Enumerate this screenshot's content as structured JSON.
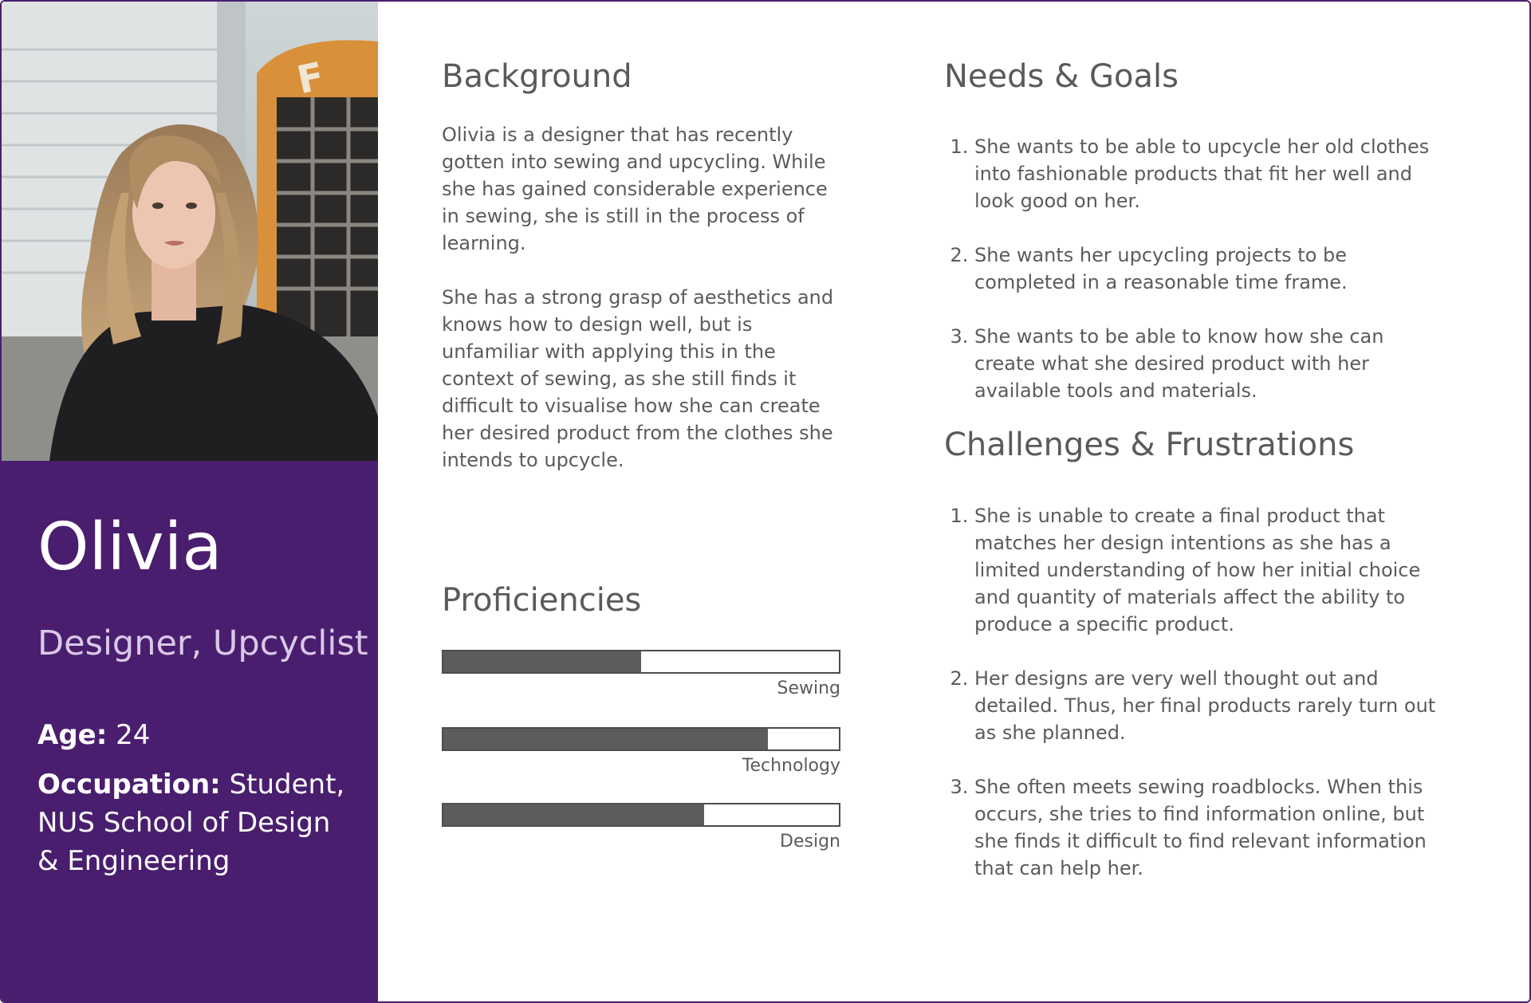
{
  "persona": {
    "name": "Olivia",
    "role": "Designer, Upcyclist",
    "age_label": "Age:",
    "age_value": "24",
    "occupation_label": "Occupation:",
    "occupation_value": "Student, NUS School of Design & Engineering"
  },
  "background": {
    "title": "Background",
    "paragraphs": [
      "Olivia is a designer that has recently gotten into sewing and upcycling. While she has gained considerable experience in sewing, she is still in the process of learning.",
      "She has a strong grasp of aesthetics and knows how to design well, but is unfamiliar with applying this in the context of sewing, as she still finds it difficult to visualise how she can create her desired product from the clothes she intends to upcycle."
    ]
  },
  "proficiencies": {
    "title": "Proficiencies",
    "items": [
      {
        "label": "Sewing",
        "level": 0.5
      },
      {
        "label": "Technology",
        "level": 0.82
      },
      {
        "label": "Design",
        "level": 0.66
      }
    ]
  },
  "needs_goals": {
    "title": "Needs & Goals",
    "items": [
      "She wants to be able to upcycle her old clothes into fashionable products that fit her well and look good on her.",
      "She wants her upcycling projects to be completed in a reasonable time frame.",
      "She wants to be able to know how she can create what she desired product with her available tools and materials."
    ]
  },
  "challenges": {
    "title": "Challenges & Frustrations",
    "items": [
      "She is unable to create a final product that matches her design intentions as she has a limited understanding of how her initial choice and quantity of materials affect the ability to produce a specific product.",
      "Her designs are very well thought out and detailed. Thus, her final products rarely turn out as she planned.",
      "She often meets sewing roadblocks. When this occurs, she tries to find information online, but she finds it difficult to find relevant information that can help her."
    ]
  },
  "colors": {
    "sidebar": "#4a1e6e",
    "heading": "#5a5a5a",
    "bar_fill": "#5c5c5c"
  }
}
